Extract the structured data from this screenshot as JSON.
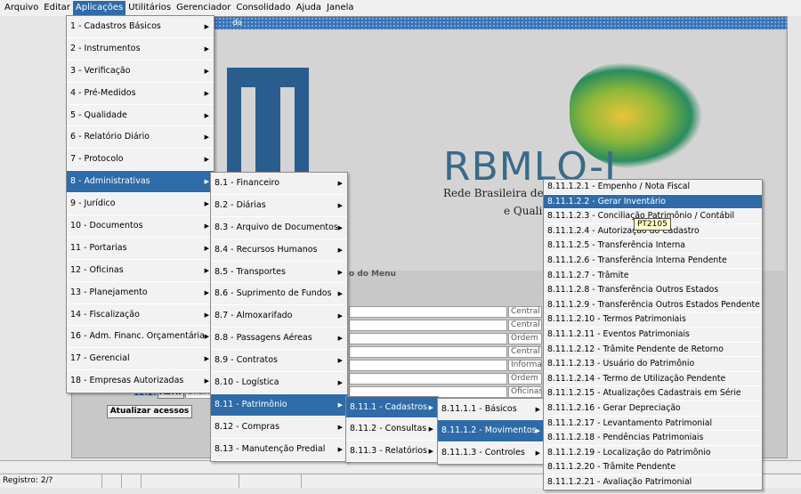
{
  "menubar": [
    "Arquivo",
    "Editar",
    "Aplicações",
    "Utilitários",
    "Gerenciador",
    "Consolidado",
    "Ajuda",
    "Janela"
  ],
  "window": {
    "title_fragment": "da",
    "logo_text": "RBMLQ-I",
    "logo_sub1": "Rede Brasileira de Me",
    "logo_sub2": "e Qualid",
    "menu_caption": "o do Menu",
    "field_labels": [
      "Central d",
      "Central d",
      "Ordem de",
      "Central d",
      "Informativ",
      "Ordem de",
      "Oficinas"
    ],
    "version": "12.2.1",
    "abrir": "Abrir",
    "oficina_field": "Oficin",
    "atualizar": "Atualizar acessos"
  },
  "menu_aplicacoes": [
    "1 - Cadastros Básicos",
    "2 - Instrumentos",
    "3 - Verificação",
    "4 - Pré-Medidos",
    "5 - Qualidade",
    "6 - Relatório Diário",
    "7 - Protocolo",
    "8 - Administrativas",
    "9 - Jurídico",
    "10 - Documentos",
    "11 - Portarias",
    "12 - Oficinas",
    "13 - Planejamento",
    "14 - Fiscalização",
    "16 - Adm. Financ. Orçamentária",
    "17 - Gerencial",
    "18 - Empresas Autorizadas"
  ],
  "menu_administrativas": [
    "8.1 - Financeiro",
    "8.2 - Diárias",
    "8.3 - Arquivo de Documentos",
    "8.4 - Recursos Humanos",
    "8.5 - Transportes",
    "8.6 - Suprimento de Fundos",
    "8.7 - Almoxarifado",
    "8.8 - Passagens Aéreas",
    "8.9 - Contratos",
    "8.10 - Logística",
    "8.11 - Patrimônio",
    "8.12 - Compras",
    "8.13 - Manutenção Predial"
  ],
  "menu_patrimonio": [
    "8.11.1 - Cadastros",
    "8.11.2 - Consultas",
    "8.11.3 - Relatórios"
  ],
  "menu_cadastros": [
    "8.11.1.1 - Básicos",
    "8.11.1.2 - Movimentos",
    "8.11.1.3 - Controles"
  ],
  "menu_movimentos": [
    "8.11.1.2.1 - Empenho / Nota Fiscal",
    "8.11.1.2.2 - Gerar Inventário",
    "8.11.1.2.3 - Conciliação Patrimônio / Contábil",
    "8.11.1.2.4 - Autorização do Cadastro",
    "8.11.1.2.5 - Transferência Interna",
    "8.11.1.2.6 - Transferência Interna Pendente",
    "8.11.1.2.7 - Trâmite",
    "8.11.1.2.8 - Transferência Outros Estados",
    "8.11.1.2.9 - Transferência Outros Estados Pendente",
    "8.11.1.2.10 - Termos Patrimoniais",
    "8.11.1.2.11 - Eventos Patrimoniais",
    "8.11.1.2.12 - Trâmite Pendente de Retorno",
    "8.11.1.2.13 - Usuário do Patrimônio",
    "8.11.1.2.14 - Termo de Utilização Pendente",
    "8.11.1.2.15 - Atualizações Cadastrais em Série",
    "8.11.1.2.16 - Gerar Depreciação",
    "8.11.1.2.17 - Levantamento Patrimonial",
    "8.11.1.2.18 - Pendências Patrimoniais",
    "8.11.1.2.19 - Localização do Patrimônio",
    "8.11.1.2.20 - Trâmite Pendente",
    "8.11.1.2.21 - Avaliação Patrimonial"
  ],
  "tooltip": "PT2105",
  "status": {
    "registro": "Registro: 2/?"
  },
  "colors": {
    "selection": "#2e6ba8",
    "titlebar": "#3874b8"
  }
}
